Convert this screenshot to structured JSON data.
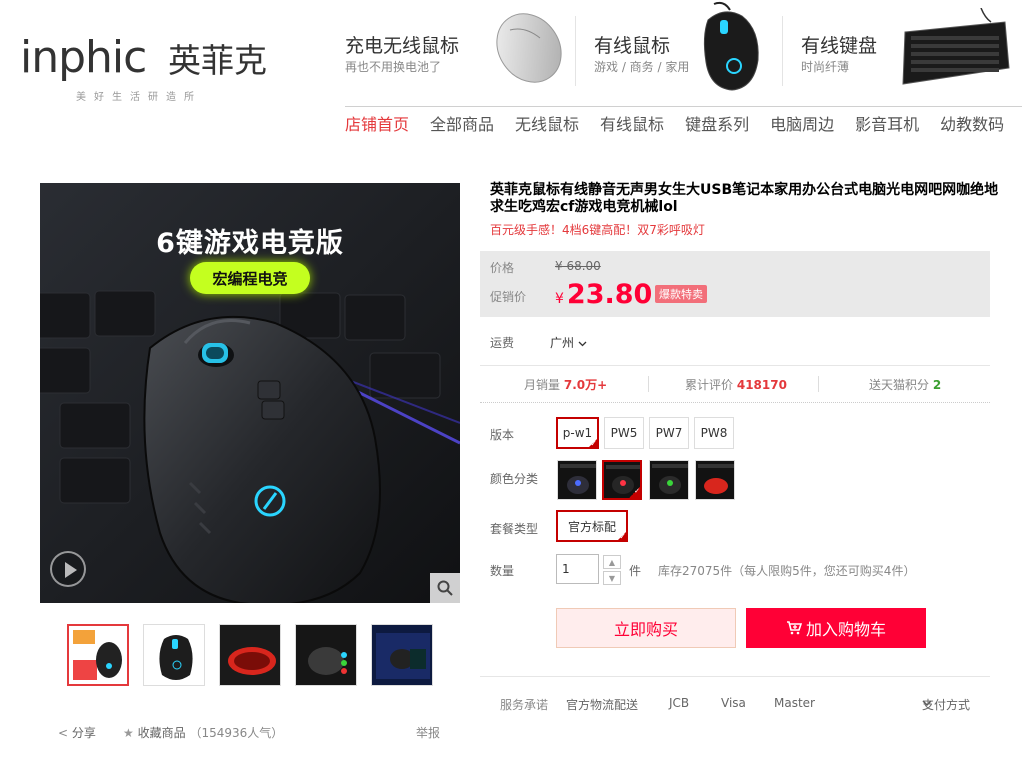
{
  "brand": {
    "wordmark": "inphic",
    "name_cn": "英菲克",
    "slogan": "美好生活研造所"
  },
  "promos": [
    {
      "title": "充电无线鼠标",
      "sub": "再也不用换电池了",
      "icon": "silver-wireless-mouse"
    },
    {
      "title": "有线鼠标",
      "sub": "游戏 / 商务 / 家用",
      "icon": "black-gaming-mouse"
    },
    {
      "title": "有线键盘",
      "sub": "时尚纤薄",
      "icon": "black-keyboard"
    }
  ],
  "nav": [
    "店铺首页",
    "全部商品",
    "无线鼠标",
    "有线鼠标",
    "键盘系列",
    "电脑周边",
    "影音耳机",
    "幼教数码"
  ],
  "gallery": {
    "banner_title": "6键游戏电竞版",
    "banner_badge": "宏编程电竞",
    "thumb_count": 5
  },
  "share": {
    "share_label": "分享",
    "fav_label": "收藏商品",
    "popularity": "（154936人气）",
    "report_label": "举报"
  },
  "product": {
    "title": "英菲克鼠标有线静音无声男女生大USB笔记本家用办公台式电脑光电网吧网咖绝地求生吃鸡宏cf游戏电竞机械lol",
    "subtitle": "百元级手感！4档6键高配！双7彩呼吸灯"
  },
  "price": {
    "orig_label": "价格",
    "orig_value": "¥ 68.00",
    "promo_label": "促销价",
    "currency": "¥",
    "current": "23.80",
    "tag": "爆款特卖"
  },
  "shipping": {
    "label": "运费",
    "city": "广州",
    "chevron": "chevron-down-icon"
  },
  "stats": {
    "monthly_label": "月销量",
    "monthly_value": "7.0万+",
    "reviews_label": "累计评价",
    "reviews_value": "418170",
    "points_label": "送天猫积分",
    "points_value": "2"
  },
  "attributes": {
    "version_label": "版本",
    "versions": [
      "p-w1",
      "PW5",
      "PW7",
      "PW8"
    ],
    "selected_version": "p-w1",
    "color_label": "颜色分类",
    "colors": [
      "blue-light",
      "red-light",
      "green-light",
      "red"
    ],
    "package_label": "套餐类型",
    "package_option": "官方标配",
    "qty_label": "数量",
    "qty_value": "1",
    "qty_unit": "件",
    "stock": "库存27075件（每人限购5件，您还可购买4件）"
  },
  "actions": {
    "buy_now": "立即购买",
    "add_cart": "加入购物车"
  },
  "service": {
    "label": "服务承诺",
    "items": [
      "官方物流配送",
      "JCB",
      "Visa",
      "Master"
    ],
    "payment": "支付方式"
  },
  "colors": {
    "accent": "#ff0036",
    "nav_active": "#e4393c",
    "selected_border": "#c40000"
  }
}
